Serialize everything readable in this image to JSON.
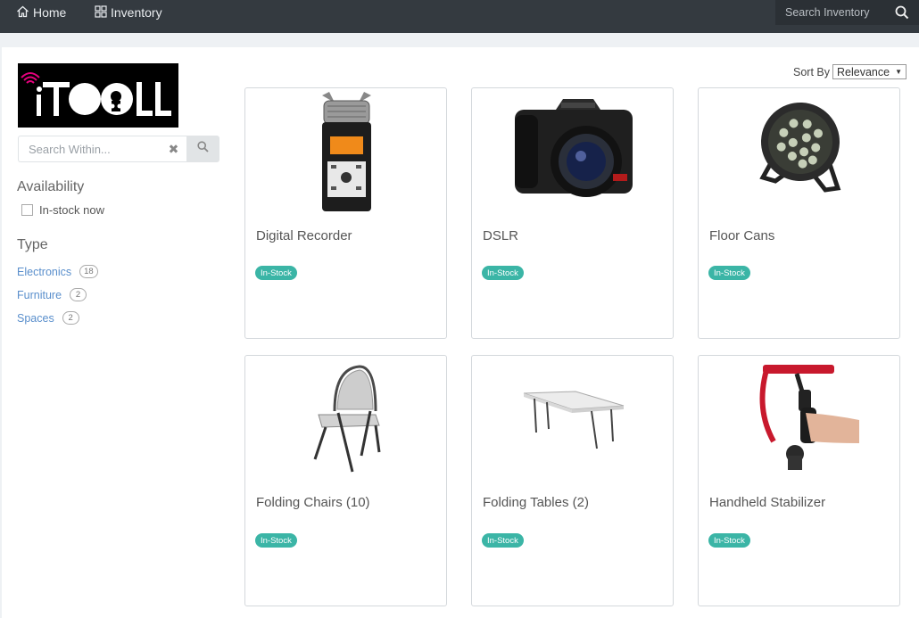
{
  "nav": {
    "home_label": "Home",
    "inventory_label": "Inventory",
    "search_placeholder": "Search Inventory"
  },
  "logo": {
    "text": "iTOOLL"
  },
  "sidebar": {
    "search_placeholder": "Search Within...",
    "clear_symbol": "✖",
    "availability_title": "Availability",
    "in_stock_label": "In-stock now",
    "type_title": "Type",
    "types": [
      {
        "label": "Electronics",
        "count": "18"
      },
      {
        "label": "Furniture",
        "count": "2"
      },
      {
        "label": "Spaces",
        "count": "2"
      }
    ]
  },
  "sort": {
    "label": "Sort By",
    "value": "Relevance"
  },
  "products": [
    {
      "title": "Digital Recorder",
      "status": "In-Stock",
      "icon": "audio-recorder-image"
    },
    {
      "title": "DSLR",
      "status": "In-Stock",
      "icon": "camera-image"
    },
    {
      "title": "Floor Cans",
      "status": "In-Stock",
      "icon": "par-light-image"
    },
    {
      "title": "Folding Chairs (10)",
      "status": "In-Stock",
      "icon": "folding-chair-image"
    },
    {
      "title": "Folding Tables (2)",
      "status": "In-Stock",
      "icon": "folding-table-image"
    },
    {
      "title": "Handheld Stabilizer",
      "status": "In-Stock",
      "icon": "stabilizer-image"
    }
  ],
  "colors": {
    "topbar": "#343a40",
    "badge": "#3bb5a6",
    "link": "#5a8fcc"
  }
}
